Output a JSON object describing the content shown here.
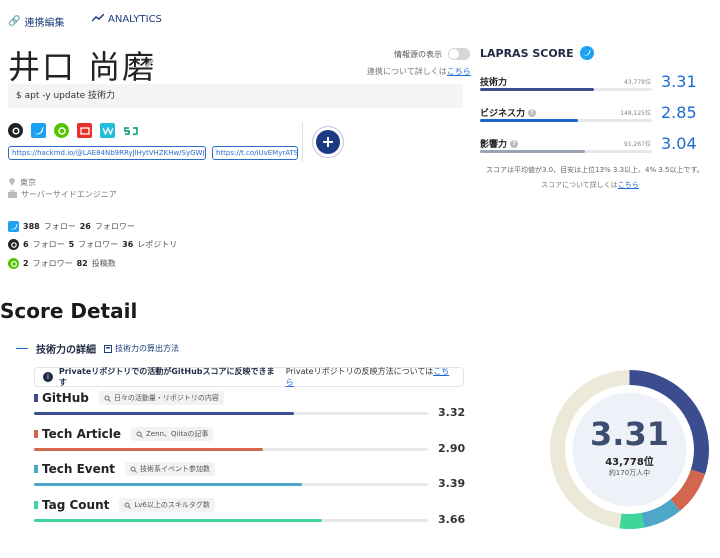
{
  "header": {
    "edit_link": "連携編集",
    "analytics_link": "ANALYTICS"
  },
  "profile": {
    "name": "井口 尚磨",
    "toggle_label": "情報源の表示",
    "link_note_prefix": "連携について詳しくは",
    "link_note_link": "こちら",
    "bio": "$ apt -y update 技術力",
    "urls": [
      "https://hackmd.io/@LAE84Nb9RRyJlHytVHZKHw/SyGWjVjS5",
      "https://t.co/iUvEMyrATS"
    ],
    "location": "東京",
    "job": "サーバーサイドエンジニア",
    "sns_icons": [
      "github-icon",
      "twitter-icon",
      "qiita-icon",
      "speakerdeck-icon",
      "wantedly-icon",
      "sj-icon"
    ]
  },
  "stats": {
    "twitter": {
      "follow": "388",
      "follow_label": "フォロー",
      "follower": "26",
      "follower_label": "フォロワー"
    },
    "github": {
      "follow": "6",
      "follow_label": "フォロー",
      "follower": "5",
      "follower_label": "フォロワー",
      "repo": "36",
      "repo_label": "レポジトリ"
    },
    "qiita": {
      "follow": "2",
      "follow_label": "フォロワー",
      "posts": "82",
      "posts_label": "投稿数"
    }
  },
  "lapras": {
    "title": "LAPRAS SCORE",
    "scores": [
      {
        "label": "技術力",
        "rank": "43,778位",
        "value": "3.31",
        "fraction": 0.66,
        "color": "#3b4d8f"
      },
      {
        "label": "ビジネス力",
        "rank": "148,125位",
        "value": "2.85",
        "fraction": 0.57,
        "color": "#1e63c6"
      },
      {
        "label": "影響力",
        "rank": "91,267位",
        "value": "3.04",
        "fraction": 0.61,
        "color": "#9aa3b2"
      }
    ],
    "note": "スコアは平均値が3.0、目安は上位13% 3.3以上、4% 3.5以上です。",
    "more_prefix": "スコアについて詳しくは",
    "more_link": "こちら"
  },
  "detail": {
    "heading": "Score Detail",
    "tab_label": "技術力の詳細",
    "calc_link": "技術力の算出方法",
    "info_bold": "Privateリポジトリでの活動がGitHubスコアに反映できます",
    "info_rest": "Privateリポジトリの反映方法については",
    "info_link": "こちら",
    "rows": [
      {
        "title": "GitHub",
        "tag": "日々の活動量・リポジトリの内容",
        "score": "3.32",
        "fraction": 0.66,
        "color": "#3b4d8f"
      },
      {
        "title": "Tech Article",
        "tag": "Zenn、Qiitaの記事",
        "score": "2.90",
        "fraction": 0.58,
        "color": "#d2664f"
      },
      {
        "title": "Tech Event",
        "tag": "技術系イベント参加数",
        "score": "3.39",
        "fraction": 0.68,
        "color": "#4ea6c8"
      },
      {
        "title": "Tag Count",
        "tag": "Lv6以上のスキルタグ数",
        "score": "3.66",
        "fraction": 0.73,
        "color": "#3fd69a"
      }
    ]
  },
  "donut": {
    "value": "3.31",
    "rank": "43,778位",
    "sub": "約170万人中",
    "segments": [
      {
        "name": "GitHub",
        "fraction": 0.3,
        "color": "#3b4d8f"
      },
      {
        "name": "Tech Article",
        "fraction": 0.09,
        "color": "#d2664f"
      },
      {
        "name": "Tech Event",
        "fraction": 0.08,
        "color": "#4ea6c8"
      },
      {
        "name": "Tag Count",
        "fraction": 0.05,
        "color": "#3fd69a"
      },
      {
        "name": "rest",
        "fraction": 0.48,
        "color": "#ede9d8"
      }
    ]
  }
}
